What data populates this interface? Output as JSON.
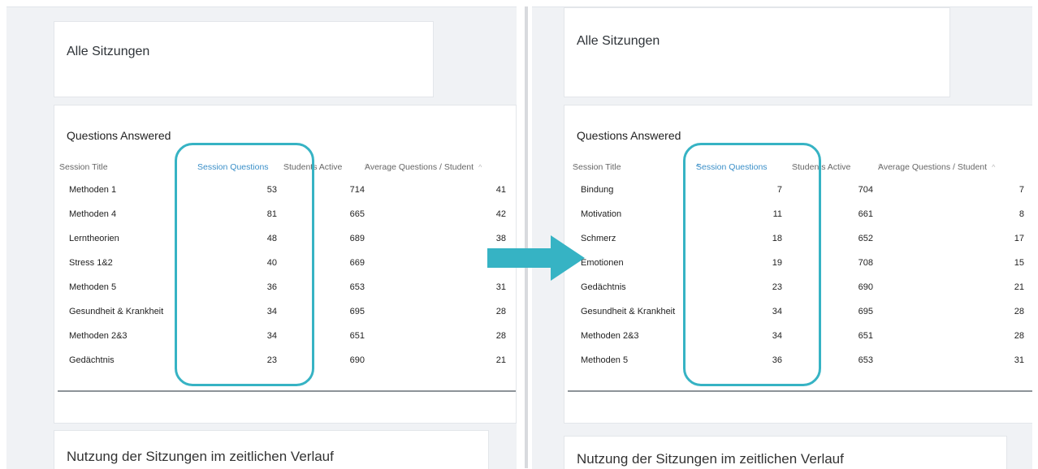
{
  "panels": {
    "before": {
      "page_title": "Alle Sitzungen",
      "card_title": "Questions Answered",
      "columns": [
        "Session Title",
        "Session Questions",
        "Students Active",
        "Average Questions / Student"
      ],
      "rows": [
        {
          "title": "Methoden 1",
          "questions": "53",
          "students": "714",
          "avg": "41"
        },
        {
          "title": "Methoden 4",
          "questions": "81",
          "students": "665",
          "avg": "42"
        },
        {
          "title": "Lerntheorien",
          "questions": "48",
          "students": "689",
          "avg": "38"
        },
        {
          "title": "Stress 1&2",
          "questions": "40",
          "students": "669",
          "avg": ""
        },
        {
          "title": "Methoden 5",
          "questions": "36",
          "students": "653",
          "avg": "31"
        },
        {
          "title": "Gesundheit & Krankheit",
          "questions": "34",
          "students": "695",
          "avg": "28"
        },
        {
          "title": "Methoden 2&3",
          "questions": "34",
          "students": "651",
          "avg": "28"
        },
        {
          "title": "Gedächtnis",
          "questions": "23",
          "students": "690",
          "avg": "21"
        }
      ],
      "next_section_title": "Nutzung der Sitzungen im zeitlichen Verlauf"
    },
    "after": {
      "page_title": "Alle Sitzungen",
      "card_title": "Questions Answered",
      "columns": [
        "Session Title",
        "Session Questions",
        "Students Active",
        "Average Questions / Student"
      ],
      "rows": [
        {
          "title": "Bindung",
          "questions": "7",
          "students": "704",
          "avg": "7"
        },
        {
          "title": "Motivation",
          "questions": "11",
          "students": "661",
          "avg": "8"
        },
        {
          "title": "Schmerz",
          "questions": "18",
          "students": "652",
          "avg": "17"
        },
        {
          "title": "Emotionen",
          "questions": "19",
          "students": "708",
          "avg": "15"
        },
        {
          "title": "Gedächtnis",
          "questions": "23",
          "students": "690",
          "avg": "21"
        },
        {
          "title": "Gesundheit & Krankheit",
          "questions": "34",
          "students": "695",
          "avg": "28"
        },
        {
          "title": "Methoden 2&3",
          "questions": "34",
          "students": "651",
          "avg": "28"
        },
        {
          "title": "Methoden 5",
          "questions": "36",
          "students": "653",
          "avg": "31"
        }
      ],
      "next_section_title": "Nutzung der Sitzungen im zeitlichen Verlauf"
    }
  },
  "sort_indicator": "^",
  "colors": {
    "highlight": "#36b3c4",
    "arrow": "#36b3c4",
    "active_header": "#3a8fc8"
  }
}
